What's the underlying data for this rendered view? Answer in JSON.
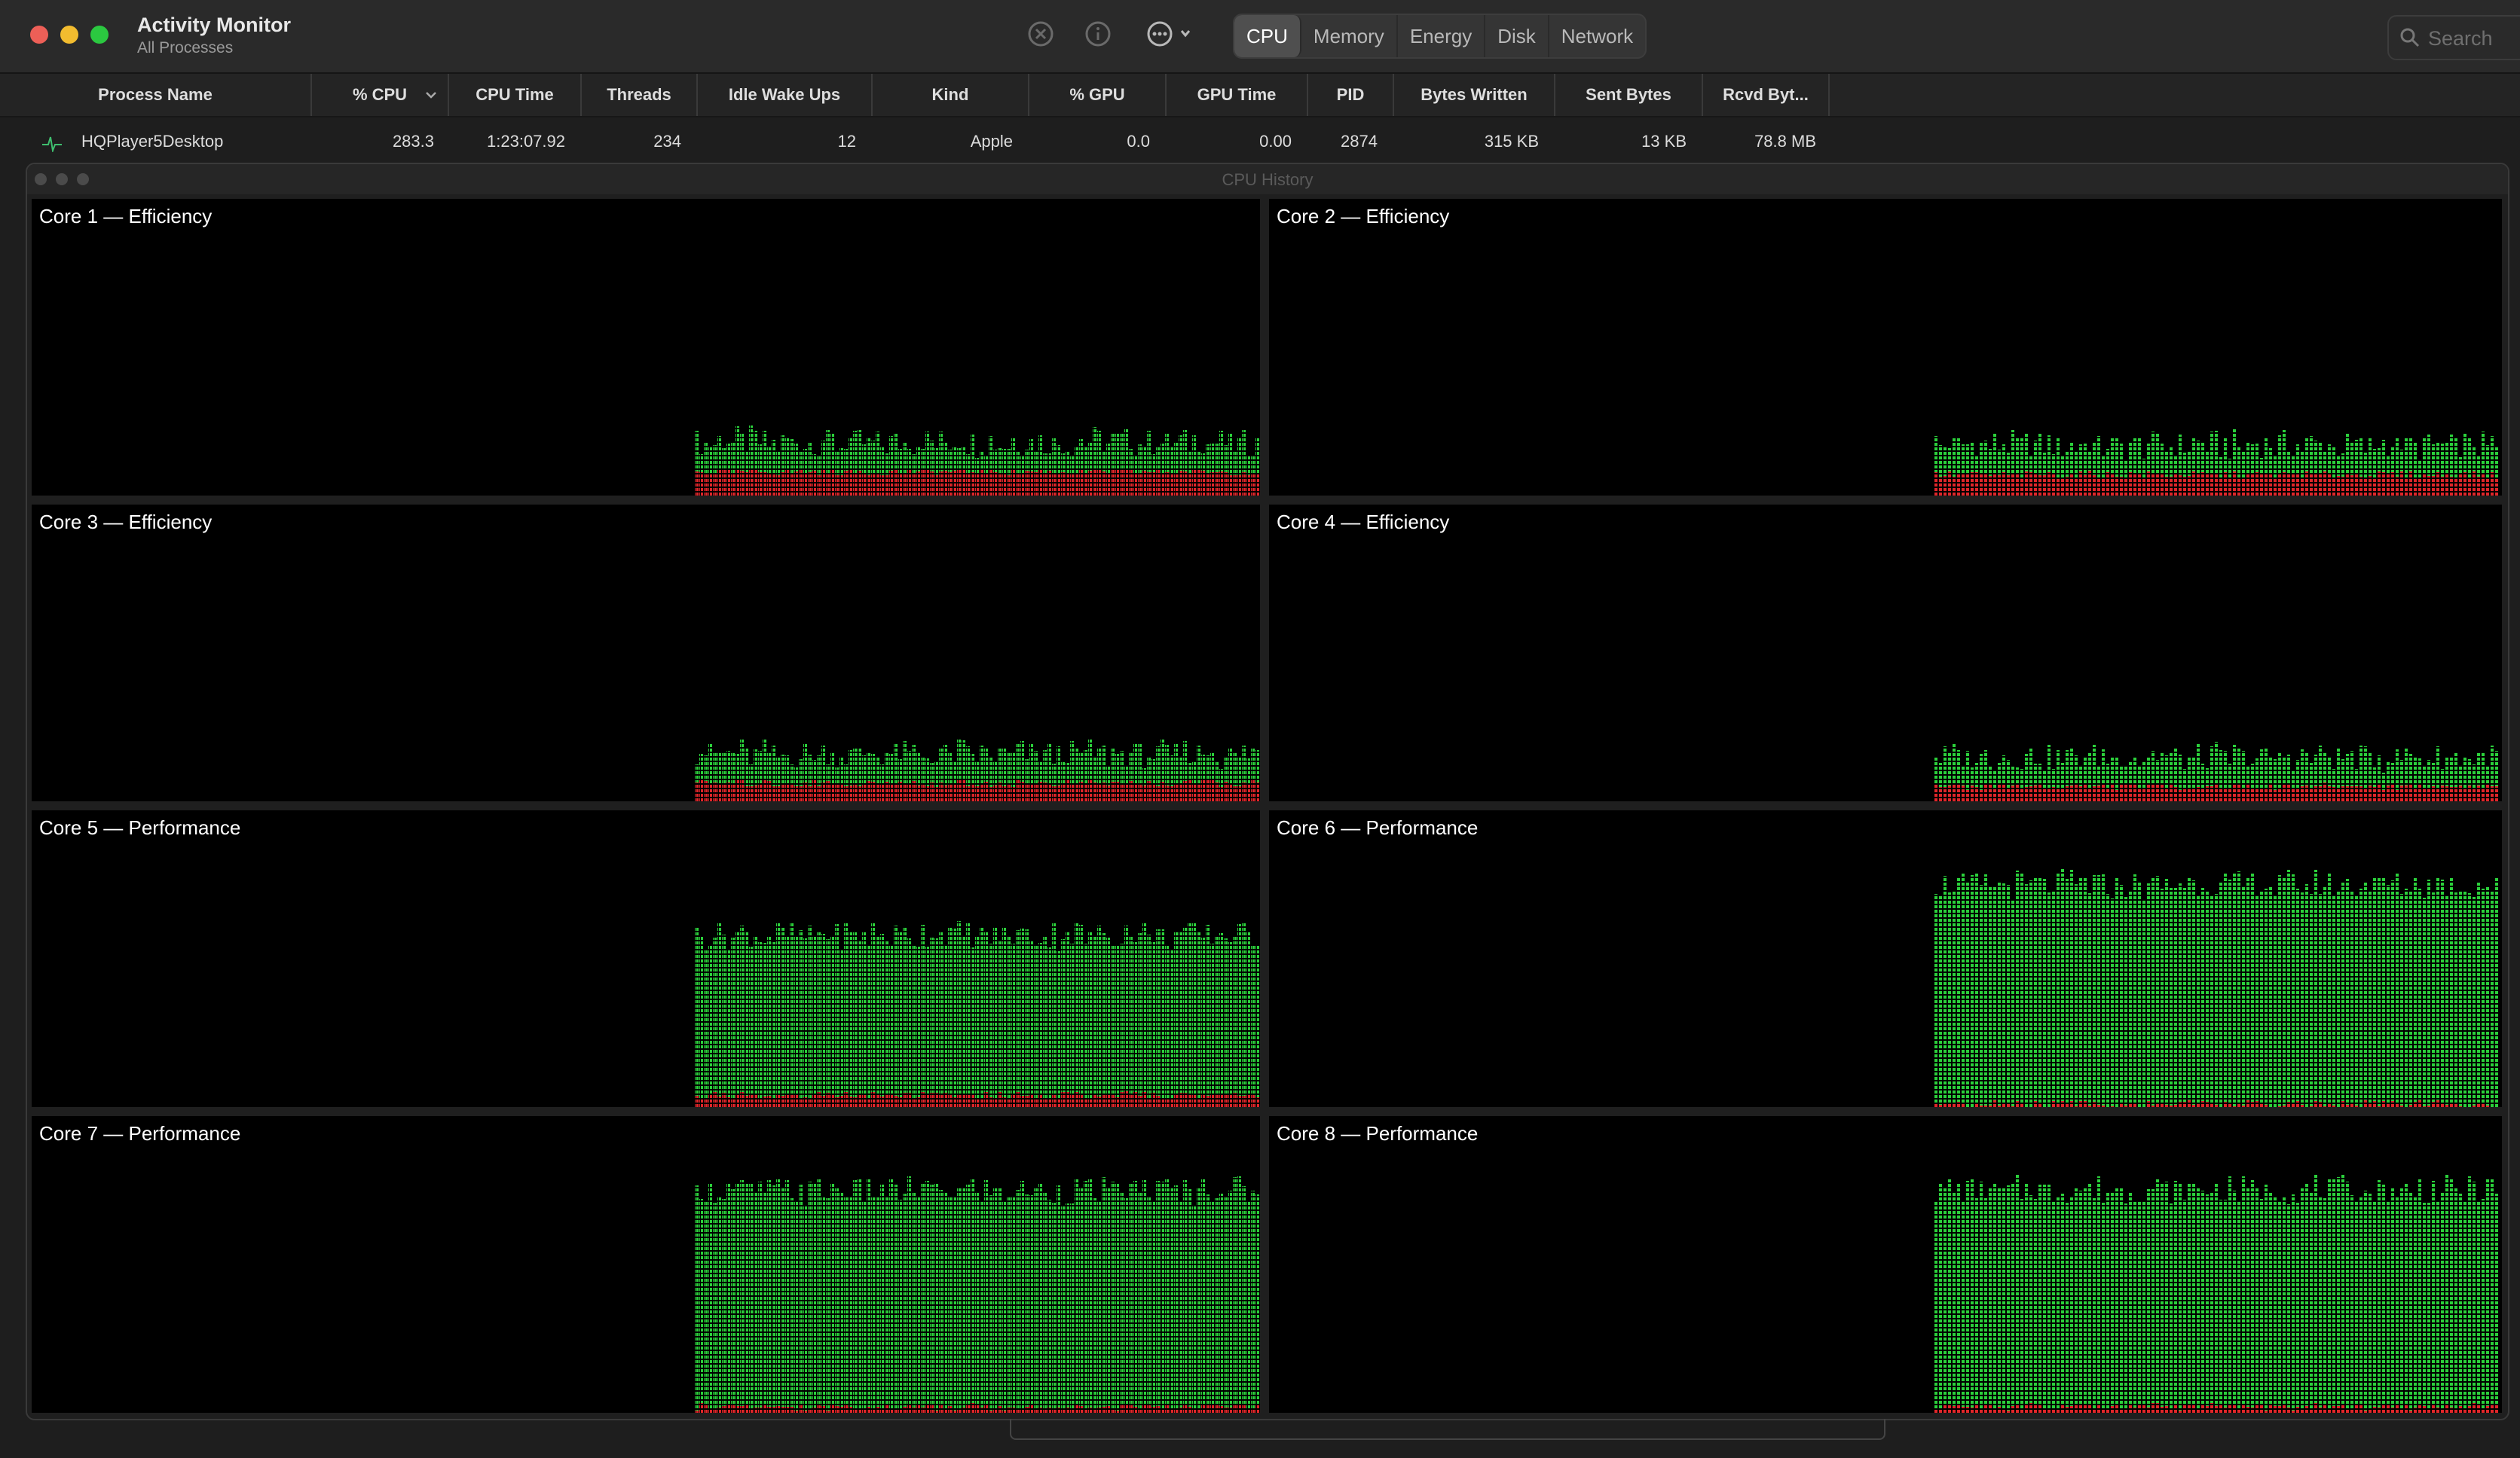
{
  "window": {
    "title": "Activity Monitor",
    "subtitle": "All Processes"
  },
  "toolbar": {
    "stop_icon": "stop-process-icon",
    "info_icon": "info-icon",
    "more_icon": "more-options-icon",
    "tabs": [
      "CPU",
      "Memory",
      "Energy",
      "Disk",
      "Network"
    ],
    "active_tab": "CPU",
    "search_placeholder": "Search"
  },
  "table": {
    "columns": [
      "Process Name",
      "% CPU",
      "CPU Time",
      "Threads",
      "Idle Wake Ups",
      "Kind",
      "% GPU",
      "GPU Time",
      "PID",
      "Bytes Written",
      "Sent Bytes",
      "Rcvd Byt..."
    ],
    "sort_column": "% CPU",
    "rows": [
      {
        "name": "HQPlayer5Desktop",
        "cpu": "283.3",
        "cpu_time": "1:23:07.92",
        "threads": "234",
        "idle_wake_ups": "12",
        "kind": "Apple",
        "gpu": "0.0",
        "gpu_time": "0.00",
        "pid": "2874",
        "bytes_written": "315 KB",
        "sent_bytes": "13 KB",
        "rcvd_bytes": "78.8 MB"
      }
    ]
  },
  "cpu_history": {
    "title": "CPU History",
    "colors": {
      "user": "#2bd03b",
      "system": "#e0262a",
      "background": "#000000"
    },
    "cores": [
      {
        "label": "Core 1 — Efficiency",
        "user": 0.1,
        "system": 0.08
      },
      {
        "label": "Core 2 — Efficiency",
        "user": 0.1,
        "system": 0.07
      },
      {
        "label": "Core 3 — Efficiency",
        "user": 0.1,
        "system": 0.06
      },
      {
        "label": "Core 4 — Efficiency",
        "user": 0.1,
        "system": 0.05
      },
      {
        "label": "Core 5 — Performance",
        "user": 0.54,
        "system": 0.04
      },
      {
        "label": "Core 6 — Performance",
        "user": 0.74,
        "system": 0.01
      },
      {
        "label": "Core 7 — Performance",
        "user": 0.73,
        "system": 0.02
      },
      {
        "label": "Core 8 — Performance",
        "user": 0.73,
        "system": 0.02
      }
    ]
  }
}
